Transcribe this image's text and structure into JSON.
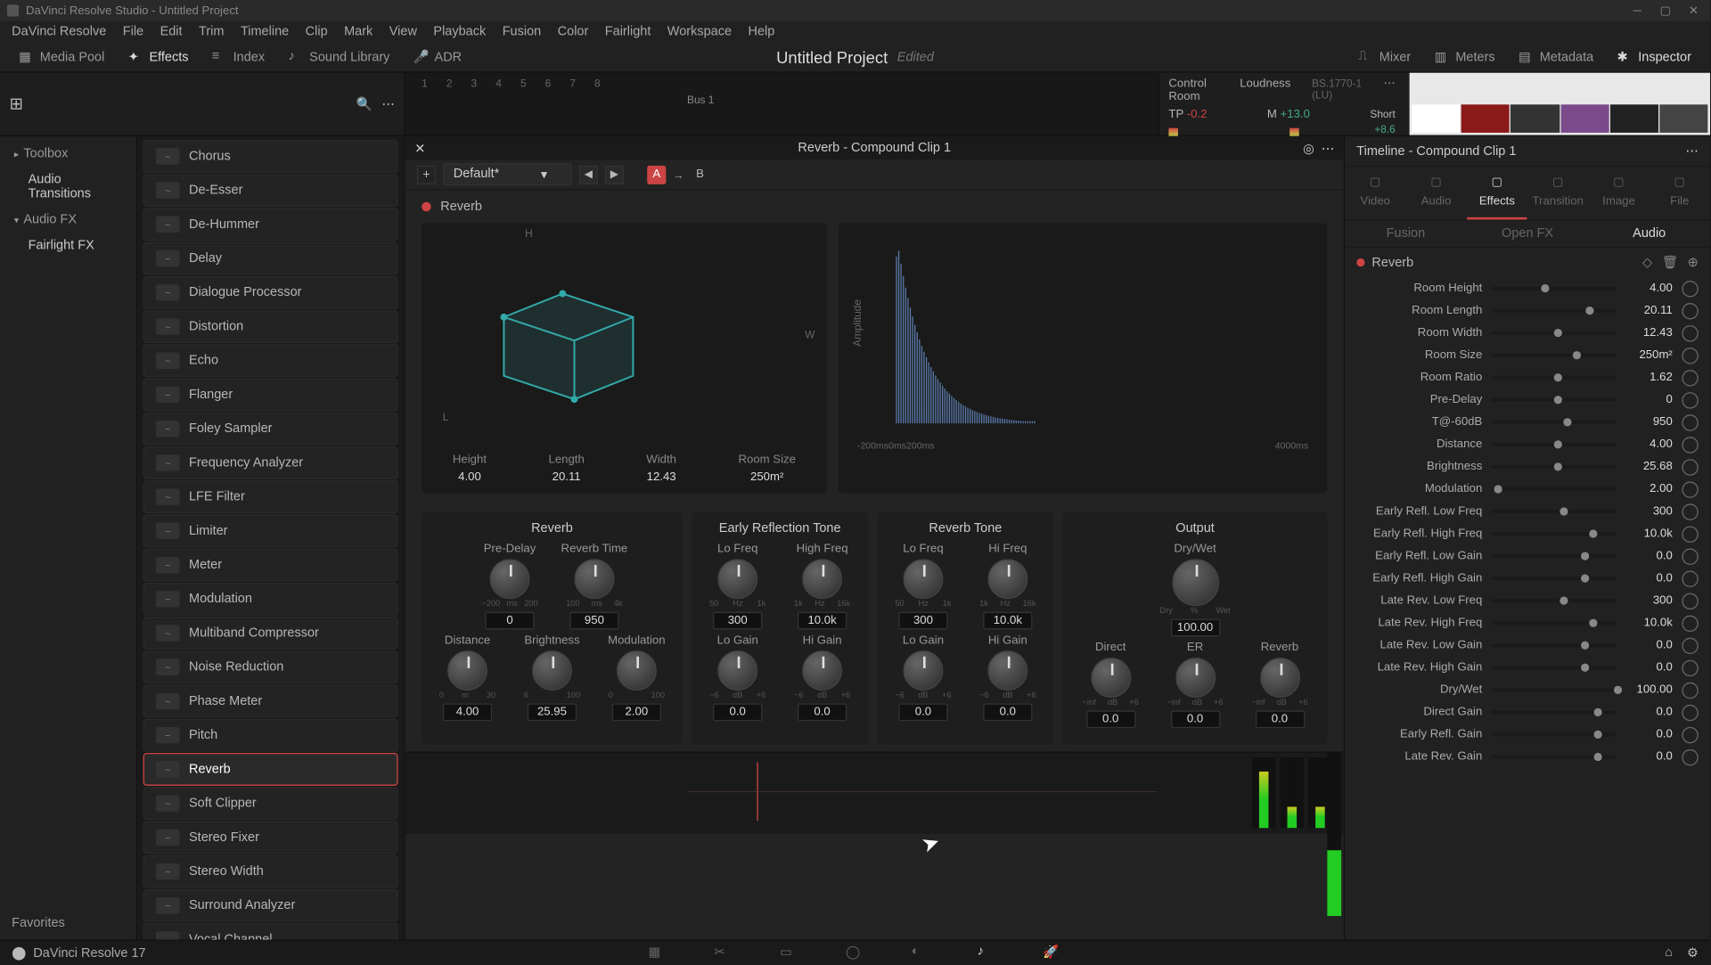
{
  "titlebar": {
    "text": "DaVinci Resolve Studio - Untitled Project"
  },
  "menu": [
    "DaVinci Resolve",
    "File",
    "Edit",
    "Trim",
    "Timeline",
    "Clip",
    "Mark",
    "View",
    "Playback",
    "Fusion",
    "Color",
    "Fairlight",
    "Workspace",
    "Help"
  ],
  "toolbar": {
    "media_pool": "Media Pool",
    "effects": "Effects",
    "index": "Index",
    "sound_library": "Sound Library",
    "adr": "ADR",
    "mixer": "Mixer",
    "meters": "Meters",
    "metadata": "Metadata",
    "inspector": "Inspector",
    "project_title": "Untitled Project",
    "project_status": "Edited"
  },
  "timeline_strip": {
    "ruler_marks": [
      "1",
      "2",
      "3",
      "4",
      "5",
      "6",
      "7",
      "8"
    ],
    "bus": "Bus 1",
    "control_room": {
      "title": "Control Room",
      "loudness": "Loudness",
      "standard": "BS.1770-1 (LU)",
      "tp_label": "TP",
      "tp_value": "-0.2",
      "m_label": "M",
      "m_value": "+13.0",
      "short_label": "Short",
      "short_value": "+8.6"
    }
  },
  "left_panel": {
    "toolbox": "Toolbox",
    "audio_transitions": "Audio Transitions",
    "audio_fx": "Audio FX",
    "fairlight_fx": "Fairlight FX"
  },
  "fx_list": [
    "Chorus",
    "De-Esser",
    "De-Hummer",
    "Delay",
    "Dialogue Processor",
    "Distortion",
    "Echo",
    "Flanger",
    "Foley Sampler",
    "Frequency Analyzer",
    "LFE Filter",
    "Limiter",
    "Meter",
    "Modulation",
    "Multiband Compressor",
    "Noise Reduction",
    "Phase Meter",
    "Pitch",
    "Reverb",
    "Soft Clipper",
    "Stereo Fixer",
    "Stereo Width",
    "Surround Analyzer",
    "Vocal Channel"
  ],
  "fx_selected_index": 18,
  "favorites": "Favorites",
  "plugin": {
    "header_title": "Reverb - Compound Clip 1",
    "preset": "Default*",
    "ab_a": "A",
    "ab_b": "B",
    "name": "Reverb",
    "room": {
      "h_axis": "H",
      "w_axis": "W",
      "l_axis": "L",
      "height_lbl": "Height",
      "height_val": "4.00",
      "length_lbl": "Length",
      "length_val": "20.11",
      "width_lbl": "Width",
      "width_val": "12.43",
      "size_lbl": "Room Size",
      "size_val": "250m²"
    },
    "decay": {
      "amp_lbl": "Amplitude",
      "ms_left": "-200ms",
      "ms_0": "0ms",
      "ms_200": "200ms",
      "ms_right": "4000ms"
    },
    "groups": {
      "reverb": {
        "title": "Reverb",
        "predelay_lbl": "Pre-Delay",
        "predelay_ticks": [
          "−200",
          "ms",
          "200"
        ],
        "predelay_val": "0",
        "time_lbl": "Reverb Time",
        "time_ticks": [
          "100",
          "ms",
          "4k"
        ],
        "time_val": "950",
        "distance_lbl": "Distance",
        "distance_ticks": [
          "0",
          "m",
          "30"
        ],
        "distance_val": "4.00",
        "brightness_lbl": "Brightness",
        "brightness_ticks": [
          "6",
          "",
          "100"
        ],
        "brightness_val": "25.95",
        "mod_lbl": "Modulation",
        "mod_ticks": [
          "0",
          "",
          "100"
        ],
        "mod_val": "2.00"
      },
      "ert": {
        "title": "Early Reflection Tone",
        "lofreq_lbl": "Lo Freq",
        "lofreq_val": "300",
        "hifreq_lbl": "High Freq",
        "hifreq_val": "10.0k",
        "logain_lbl": "Lo Gain",
        "logain_val": "0.0",
        "higain_lbl": "Hi Gain",
        "higain_val": "0.0",
        "gain_ticks": [
          "−6",
          "dB",
          "+6"
        ]
      },
      "rt": {
        "title": "Reverb Tone",
        "lofreq_lbl": "Lo Freq",
        "lofreq_val": "300",
        "hifreq_lbl": "Hi Freq",
        "hifreq_val": "10.0k",
        "logain_lbl": "Lo Gain",
        "logain_val": "0.0",
        "higain_lbl": "Hi Gain",
        "higain_val": "0.0"
      },
      "output": {
        "title": "Output",
        "drywet_lbl": "Dry/Wet",
        "drywet_ticks": [
          "Dry",
          "%",
          "Wet"
        ],
        "drywet_val": "100.00",
        "direct_lbl": "Direct",
        "direct_val": "0.0",
        "er_lbl": "ER",
        "er_val": "0.0",
        "reverb_lbl": "Reverb",
        "reverb_val": "0.0",
        "out_ticks": [
          "−inf",
          "dB",
          "+6"
        ]
      }
    }
  },
  "inspector": {
    "timeline_title": "Timeline - Compound Clip 1",
    "tabs": [
      "Video",
      "Audio",
      "Effects",
      "Transition",
      "Image",
      "File"
    ],
    "tab_active": 2,
    "subtabs": [
      "Fusion",
      "Open FX",
      "Audio"
    ],
    "subtab_active": 2,
    "fx_name": "Reverb",
    "params": [
      {
        "label": "Room Height",
        "value": "4.00",
        "pos": 40
      },
      {
        "label": "Room Length",
        "value": "20.11",
        "pos": 75
      },
      {
        "label": "Room Width",
        "value": "12.43",
        "pos": 50
      },
      {
        "label": "Room Size",
        "value": "250m²",
        "pos": 65
      },
      {
        "label": "Room Ratio",
        "value": "1.62",
        "pos": 50
      },
      {
        "label": "Pre-Delay",
        "value": "0",
        "pos": 50
      },
      {
        "label": "T@-60dB",
        "value": "950",
        "pos": 58
      },
      {
        "label": "Distance",
        "value": "4.00",
        "pos": 50
      },
      {
        "label": "Brightness",
        "value": "25.68",
        "pos": 50
      },
      {
        "label": "Modulation",
        "value": "2.00",
        "pos": 2
      },
      {
        "label": "Early Refl. Low Freq",
        "value": "300",
        "pos": 55
      },
      {
        "label": "Early Refl. High Freq",
        "value": "10.0k",
        "pos": 78
      },
      {
        "label": "Early Refl. Low Gain",
        "value": "0.0",
        "pos": 72
      },
      {
        "label": "Early Refl. High Gain",
        "value": "0.0",
        "pos": 72
      },
      {
        "label": "Late Rev. Low Freq",
        "value": "300",
        "pos": 55
      },
      {
        "label": "Late Rev. High Freq",
        "value": "10.0k",
        "pos": 78
      },
      {
        "label": "Late Rev. Low Gain",
        "value": "0.0",
        "pos": 72
      },
      {
        "label": "Late Rev. High Gain",
        "value": "0.0",
        "pos": 72
      },
      {
        "label": "Dry/Wet",
        "value": "100.00",
        "pos": 98
      },
      {
        "label": "Direct Gain",
        "value": "0.0",
        "pos": 82
      },
      {
        "label": "Early Refl. Gain",
        "value": "0.0",
        "pos": 82
      },
      {
        "label": "Late Rev. Gain",
        "value": "0.0",
        "pos": 82
      }
    ]
  },
  "bottom": {
    "app": "DaVinci Resolve 17"
  }
}
